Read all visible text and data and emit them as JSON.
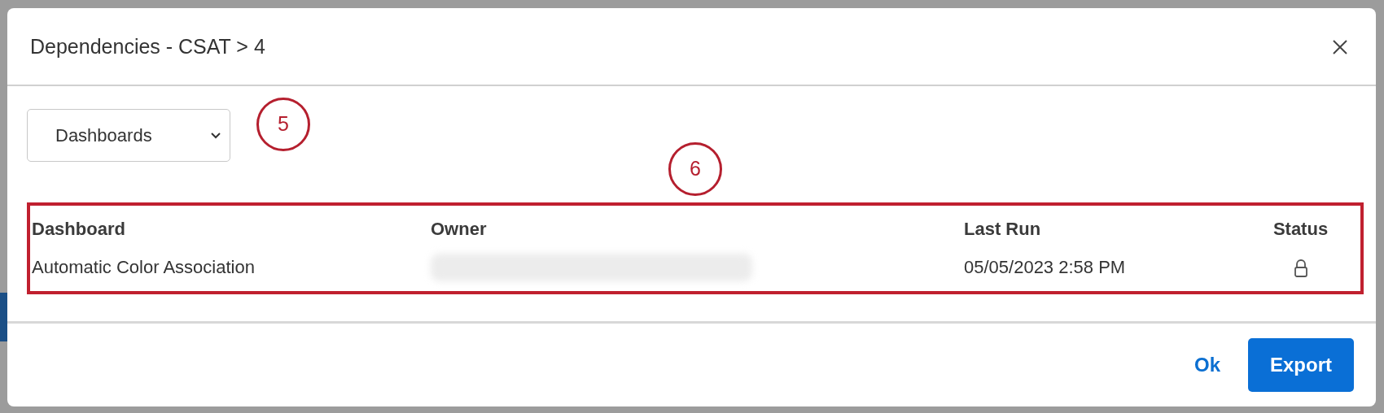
{
  "dialog": {
    "title": "Dependencies - CSAT > 4",
    "type_select": {
      "value": "Dashboards"
    },
    "table": {
      "columns": [
        "Dashboard",
        "Owner",
        "Last Run",
        "Status"
      ],
      "rows": [
        {
          "dashboard": "Automatic Color Association",
          "owner_redacted": true,
          "last_run": "05/05/2023 2:58 PM",
          "locked": true
        }
      ]
    },
    "buttons": [
      {
        "label": "Ok",
        "kind": "link"
      },
      {
        "label": "Export",
        "kind": "primary"
      }
    ]
  },
  "callouts": [
    {
      "label": "5",
      "kind": "select"
    },
    {
      "label": "6",
      "kind": "table"
    }
  ]
}
